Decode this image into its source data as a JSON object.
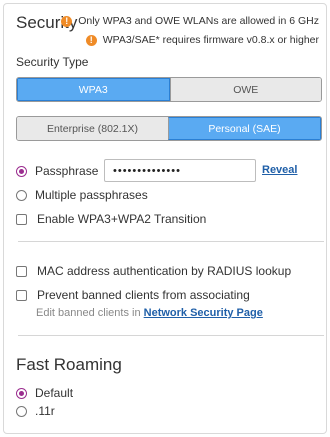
{
  "security": {
    "title": "Security",
    "warnings": [
      "Only WPA3 and OWE WLANs are allowed in 6 GHz",
      "WPA3/SAE* requires firmware v0.8.x or higher"
    ],
    "warning_icon_glyph": "!",
    "type_label": "Security Type",
    "type_options": [
      "WPA3",
      "OWE"
    ],
    "type_selected": "WPA3",
    "auth_options": [
      "Enterprise (802.1X)",
      "Personal (SAE)"
    ],
    "auth_selected": "Personal (SAE)",
    "passphrase_label": "Passphrase",
    "passphrase_value": "••••••••••••••",
    "reveal_label": "Reveal",
    "multiple_label": "Multiple passphrases",
    "transition_label": "Enable WPA3+WPA2 Transition",
    "mac_auth_label": "MAC address authentication by RADIUS lookup",
    "banned_label": "Prevent banned clients from associating",
    "banned_edit_prefix": "Edit banned clients in",
    "banned_edit_link": "Network Security Page"
  },
  "fast_roaming": {
    "title": "Fast Roaming",
    "options": [
      "Default",
      ".11r"
    ],
    "selected": "Default"
  },
  "colors": {
    "accent_blue": "#5aaaf2",
    "radio_purple": "#9b2d8f",
    "warning_orange": "#ef8b27",
    "link_blue": "#1f5fa8"
  }
}
